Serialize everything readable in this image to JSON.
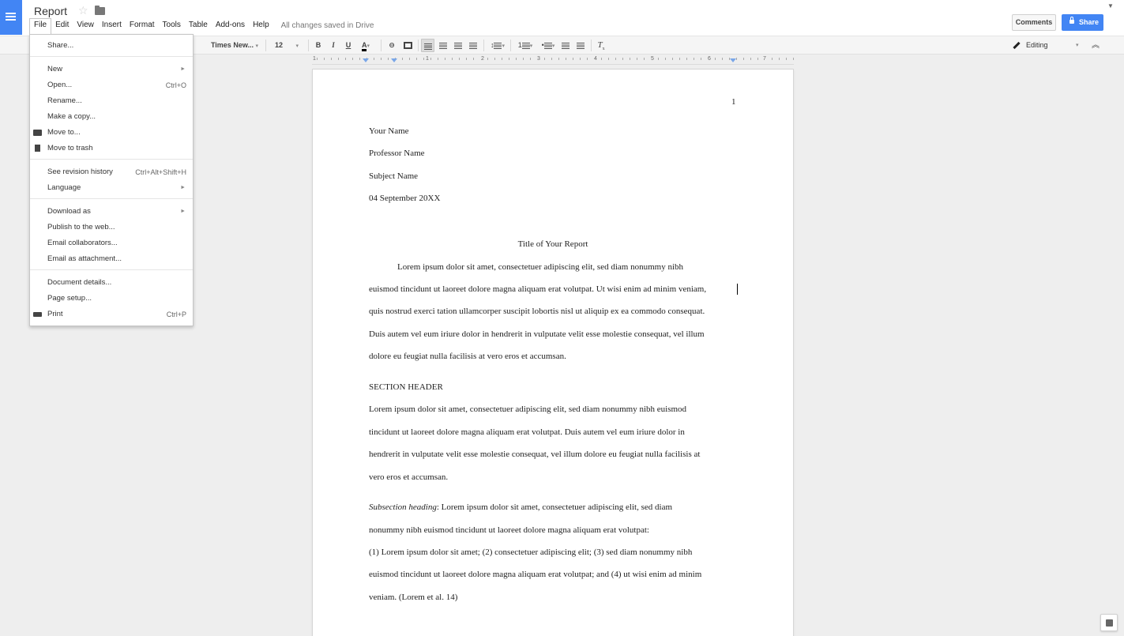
{
  "app": {
    "doc_title": "Report",
    "save_status": "All changes saved in Drive"
  },
  "menubar": [
    "File",
    "Edit",
    "View",
    "Insert",
    "Format",
    "Tools",
    "Table",
    "Add-ons",
    "Help"
  ],
  "header": {
    "comments_label": "Comments",
    "share_label": "Share"
  },
  "toolbar": {
    "font_family": "Times New...",
    "font_size": "12",
    "mode": "Editing"
  },
  "ruler": [
    "1",
    "1",
    "2",
    "3",
    "4",
    "5",
    "6",
    "7"
  ],
  "file_menu": {
    "items": [
      {
        "label": "Share...",
        "shortcut": "",
        "submenu": false,
        "icon": ""
      },
      {
        "label": "New",
        "shortcut": "",
        "submenu": true,
        "icon": ""
      },
      {
        "label": "Open...",
        "shortcut": "Ctrl+O",
        "submenu": false,
        "icon": ""
      },
      {
        "label": "Rename...",
        "shortcut": "",
        "submenu": false,
        "icon": ""
      },
      {
        "label": "Make a copy...",
        "shortcut": "",
        "submenu": false,
        "icon": ""
      },
      {
        "label": "Move to...",
        "shortcut": "",
        "submenu": false,
        "icon": "folder-icon"
      },
      {
        "label": "Move to trash",
        "shortcut": "",
        "submenu": false,
        "icon": "trash-icon"
      },
      {
        "label": "See revision history",
        "shortcut": "Ctrl+Alt+Shift+H",
        "submenu": false,
        "icon": ""
      },
      {
        "label": "Language",
        "shortcut": "",
        "submenu": true,
        "icon": ""
      },
      {
        "label": "Download as",
        "shortcut": "",
        "submenu": true,
        "icon": ""
      },
      {
        "label": "Publish to the web...",
        "shortcut": "",
        "submenu": false,
        "icon": ""
      },
      {
        "label": "Email collaborators...",
        "shortcut": "",
        "submenu": false,
        "icon": ""
      },
      {
        "label": "Email as attachment...",
        "shortcut": "",
        "submenu": false,
        "icon": ""
      },
      {
        "label": "Document details...",
        "shortcut": "",
        "submenu": false,
        "icon": ""
      },
      {
        "label": "Page setup...",
        "shortcut": "",
        "submenu": false,
        "icon": ""
      },
      {
        "label": "Print",
        "shortcut": "Ctrl+P",
        "submenu": false,
        "icon": "print-icon"
      }
    ]
  },
  "document": {
    "page_number": "1",
    "heading_lines": [
      "Your Name",
      "Professor Name",
      "Subject Name",
      "04 September 20XX"
    ],
    "title": "Title of Your Report",
    "paragraph1": [
      "Lorem ipsum dolor sit amet, consectetuer adipiscing elit, sed diam nonummy nibh",
      "euismod tincidunt ut laoreet dolore magna aliquam erat volutpat. Ut wisi enim ad minim veniam,",
      "quis nostrud exerci tation ullamcorper suscipit lobortis nisl ut aliquip ex ea commodo consequat.",
      "Duis autem vel eum iriure dolor in hendrerit in vulputate velit esse molestie consequat, vel illum",
      "dolore eu feugiat nulla facilisis at vero eros et accumsan."
    ],
    "section_header": "SECTION HEADER",
    "paragraph2": [
      "Lorem ipsum dolor sit amet, consectetuer adipiscing elit, sed diam nonummy nibh euismod",
      "tincidunt ut laoreet dolore magna aliquam erat volutpat. Duis autem vel eum iriure dolor in",
      "hendrerit in vulputate velit esse molestie consequat, vel illum dolore eu feugiat nulla facilisis at",
      "vero eros et accumsan."
    ],
    "subsection_heading": "Subsection heading",
    "paragraph3_first": ": Lorem ipsum dolor sit amet, consectetuer adipiscing elit, sed diam",
    "paragraph3": [
      "nonummy nibh euismod tincidunt ut laoreet dolore magna aliquam erat volutpat:",
      "(1) Lorem ipsum dolor sit amet; (2) consectetuer adipiscing elit; (3) sed diam nonummy nibh",
      "euismod tincidunt ut laoreet dolore magna aliquam erat volutpat; and (4) ut wisi enim ad minim",
      "veniam.  (Lorem et al. 14)"
    ]
  }
}
